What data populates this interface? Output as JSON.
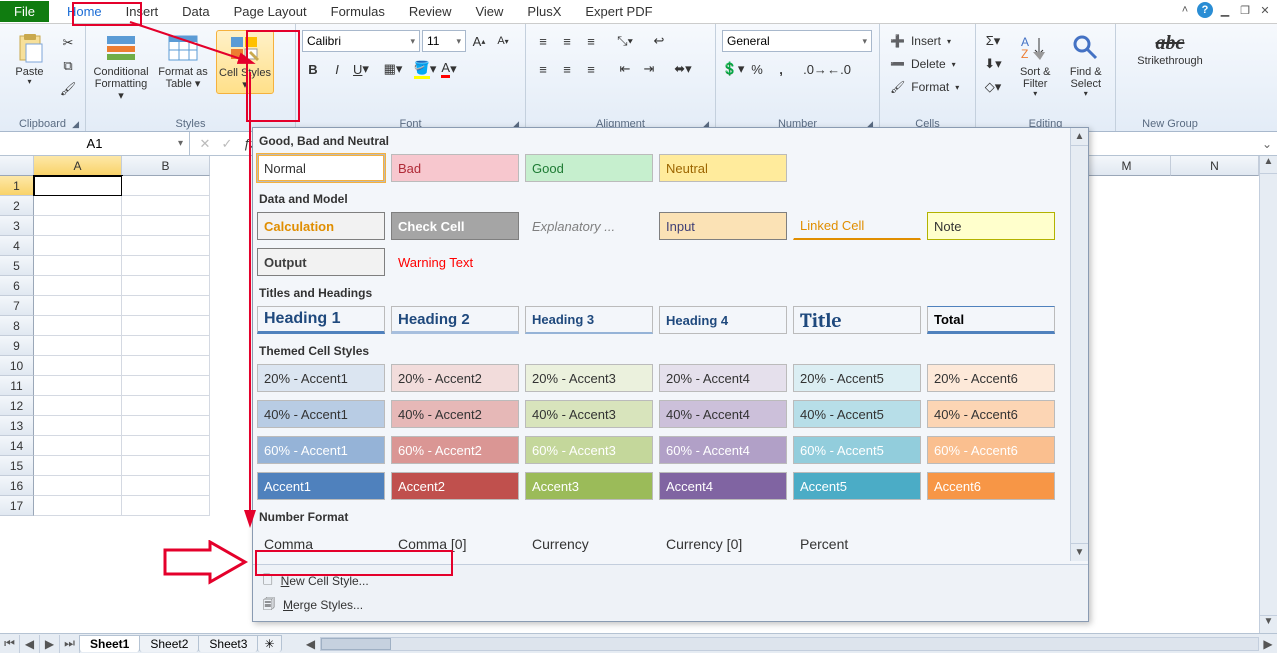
{
  "tabs": {
    "file": "File",
    "items": [
      "Home",
      "Insert",
      "Data",
      "Page Layout",
      "Formulas",
      "Review",
      "View",
      "PlusX",
      "Expert PDF"
    ],
    "active": 0
  },
  "title_buttons": {
    "help": "?",
    "min": "▁",
    "restore": "❐",
    "close": "✕",
    "up": "˄"
  },
  "ribbon": {
    "clipboard": {
      "label": "Clipboard",
      "paste": "Paste"
    },
    "styles": {
      "label": "Styles",
      "cond": "Conditional Formatting",
      "table": "Format as Table",
      "cell": "Cell Styles"
    },
    "font": {
      "name": "Calibri",
      "size": "11"
    },
    "number": {
      "label": "Number",
      "format": "General"
    },
    "cells": {
      "label": "Cells",
      "insert": "Insert",
      "delete": "Delete",
      "format": "Format"
    },
    "editing": {
      "label": "Editing",
      "sort": "Sort & Filter",
      "find": "Find & Select"
    },
    "newgroup": {
      "label": "New Group",
      "strike": "Strikethrough"
    },
    "font_label": "Font",
    "align_label": "Alignment"
  },
  "namebox": {
    "value": "A1"
  },
  "columns_left": [
    "A",
    "B"
  ],
  "columns_right": [
    "M",
    "N"
  ],
  "rows_left": [
    "1",
    "2",
    "3",
    "4",
    "5",
    "6",
    "7",
    "8",
    "9",
    "10",
    "11",
    "12",
    "13",
    "14",
    "15",
    "16",
    "17"
  ],
  "gallery": {
    "h1": "Good, Bad and Neutral",
    "r1": [
      {
        "t": "Normal",
        "bg": "#ffffff",
        "fg": "#333",
        "sel": true
      },
      {
        "t": "Bad",
        "bg": "#f7c7ce",
        "fg": "#b02a37"
      },
      {
        "t": "Good",
        "bg": "#c6efce",
        "fg": "#1e7b34"
      },
      {
        "t": "Neutral",
        "bg": "#ffeb9c",
        "fg": "#9c6500"
      }
    ],
    "h2": "Data and Model",
    "r2": [
      {
        "t": "Calculation",
        "bg": "#f2f2f2",
        "fg": "#e08e00",
        "bold": true,
        "bd": "#7f7f7f"
      },
      {
        "t": "Check Cell",
        "bg": "#a5a5a5",
        "fg": "#ffffff",
        "bold": true,
        "bd": "#7f7f7f"
      },
      {
        "t": "Explanatory ...",
        "bg": "transparent",
        "fg": "#7f7f7f",
        "italic": true,
        "nb": true
      },
      {
        "t": "Input",
        "bg": "#fbe2b5",
        "fg": "#3f3f76",
        "bd": "#7f7f7f"
      },
      {
        "t": "Linked Cell",
        "bg": "transparent",
        "fg": "#e08e00",
        "nb": true,
        "ub": "#e08e00"
      },
      {
        "t": "Note",
        "bg": "#ffffcc",
        "fg": "#333",
        "bd": "#b2b200"
      }
    ],
    "r2b": [
      {
        "t": "Output",
        "bg": "#f2f2f2",
        "fg": "#3f3f3f",
        "bold": true,
        "bd": "#7f7f7f"
      },
      {
        "t": "Warning Text",
        "bg": "transparent",
        "fg": "#ff0000",
        "nb": true
      }
    ],
    "h3": "Titles and Headings",
    "r3": [
      {
        "t": "Heading 1",
        "fg": "#1f497d",
        "fs": "16px",
        "bold": true,
        "ub": "#4f81bd",
        "uth": "3px"
      },
      {
        "t": "Heading 2",
        "fg": "#1f497d",
        "fs": "15px",
        "bold": true,
        "ub": "#a7bfde",
        "uth": "3px"
      },
      {
        "t": "Heading 3",
        "fg": "#1f497d",
        "fs": "13px",
        "bold": true,
        "ub": "#95b3d7",
        "uth": "2px"
      },
      {
        "t": "Heading 4",
        "fg": "#1f497d",
        "fs": "13px",
        "bold": true
      },
      {
        "t": "Title",
        "fg": "#1f497d",
        "fs": "20px",
        "bold": true,
        "serif": true
      },
      {
        "t": "Total",
        "fg": "#000",
        "fs": "13px",
        "bold": true,
        "ub": "#4f81bd",
        "uth": "3px",
        "tb": "#4f81bd"
      }
    ],
    "h4": "Themed Cell Styles",
    "r4": [
      [
        "20% - Accent1",
        "#dbe5f1",
        "#333"
      ],
      [
        "20% - Accent2",
        "#f2dcdb",
        "#333"
      ],
      [
        "20% - Accent3",
        "#ebf1dd",
        "#333"
      ],
      [
        "20% - Accent4",
        "#e5e0ec",
        "#333"
      ],
      [
        "20% - Accent5",
        "#dbeef3",
        "#333"
      ],
      [
        "20% - Accent6",
        "#fde9d9",
        "#333"
      ]
    ],
    "r5": [
      [
        "40% - Accent1",
        "#b8cce4",
        "#333"
      ],
      [
        "40% - Accent2",
        "#e6b8b7",
        "#333"
      ],
      [
        "40% - Accent3",
        "#d8e4bc",
        "#333"
      ],
      [
        "40% - Accent4",
        "#ccc0da",
        "#333"
      ],
      [
        "40% - Accent5",
        "#b7dee8",
        "#333"
      ],
      [
        "40% - Accent6",
        "#fcd5b4",
        "#333"
      ]
    ],
    "r6": [
      [
        "60% - Accent1",
        "#95b3d7",
        "#fff"
      ],
      [
        "60% - Accent2",
        "#da9694",
        "#fff"
      ],
      [
        "60% - Accent3",
        "#c4d79b",
        "#fff"
      ],
      [
        "60% - Accent4",
        "#b1a0c7",
        "#fff"
      ],
      [
        "60% - Accent5",
        "#92cddc",
        "#fff"
      ],
      [
        "60% - Accent6",
        "#fabf8f",
        "#fff"
      ]
    ],
    "r7": [
      [
        "Accent1",
        "#4f81bd",
        "#fff"
      ],
      [
        "Accent2",
        "#c0504d",
        "#fff"
      ],
      [
        "Accent3",
        "#9bbb59",
        "#fff"
      ],
      [
        "Accent4",
        "#8064a2",
        "#fff"
      ],
      [
        "Accent5",
        "#4bacc6",
        "#fff"
      ],
      [
        "Accent6",
        "#f79646",
        "#fff"
      ]
    ],
    "h5": "Number Format",
    "r8": [
      {
        "t": "Comma"
      },
      {
        "t": "Comma [0]"
      },
      {
        "t": "Currency"
      },
      {
        "t": "Currency [0]"
      },
      {
        "t": "Percent"
      }
    ],
    "footer": {
      "new": "New Cell Style...",
      "new_u": "N",
      "merge": "Merge Styles...",
      "merge_u": "M"
    }
  },
  "sheets": {
    "items": [
      "Sheet1",
      "Sheet2",
      "Sheet3"
    ],
    "active": 0
  }
}
